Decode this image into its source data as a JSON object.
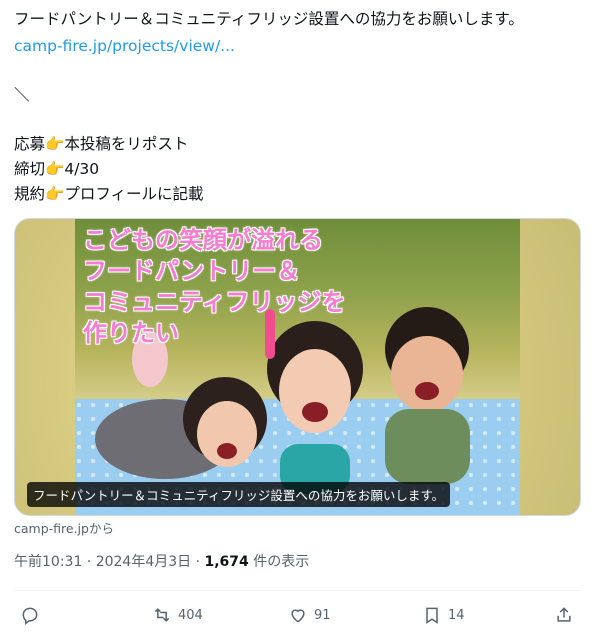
{
  "tweet": {
    "text_line_1": "フードパントリー＆コミュニティフリッジ設置への協力をお願いします。",
    "link": "camp-fire.jp/projects/view/...",
    "backslash": "＼",
    "rows": [
      {
        "label": "応募",
        "emoji": "👉",
        "value": "本投稿をリポスト"
      },
      {
        "label": "締切",
        "emoji": "👉",
        "value": "4/30"
      },
      {
        "label": "規約",
        "emoji": "👉",
        "value": "プロフィールに記載"
      }
    ]
  },
  "card": {
    "image_heading_lines": [
      "こどもの笑顔が溢れる",
      "フードパントリー＆",
      "コミュニティフリッジを",
      "作りたい"
    ],
    "caption": "フードパントリー＆コミュニティフリッジ設置への協力をお願いします。",
    "source": "camp-fire.jpから"
  },
  "meta": {
    "time_date": "午前10:31 · 2024年4月3日 · ",
    "views_count": "1,674",
    "views_label": " 件の表示"
  },
  "actions": {
    "reply": {
      "icon": "reply-icon",
      "count": ""
    },
    "repost": {
      "icon": "repost-icon",
      "count": "404"
    },
    "like": {
      "icon": "heart-icon",
      "count": "91"
    },
    "bookmark": {
      "icon": "bookmark-icon",
      "count": "14"
    },
    "share": {
      "icon": "share-icon",
      "count": ""
    }
  }
}
